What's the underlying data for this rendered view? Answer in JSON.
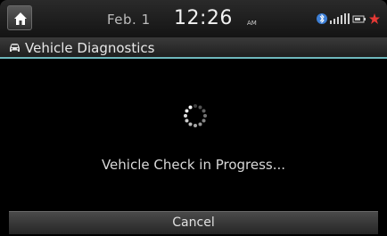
{
  "status_bar": {
    "home_icon": "home-icon",
    "date": "Feb.  1",
    "time": "12:26",
    "ampm": "AM",
    "icons": [
      "bluetooth-icon",
      "signal-bars-icon",
      "battery-icon",
      "alert-icon"
    ]
  },
  "title_bar": {
    "icon": "car-icon",
    "title": "Vehicle Diagnostics",
    "accent_color": "#6fb8bd"
  },
  "main": {
    "spinner_icon": "loading-spinner-icon",
    "message": "Vehicle Check in Progress..."
  },
  "footer": {
    "cancel_label": "Cancel"
  }
}
